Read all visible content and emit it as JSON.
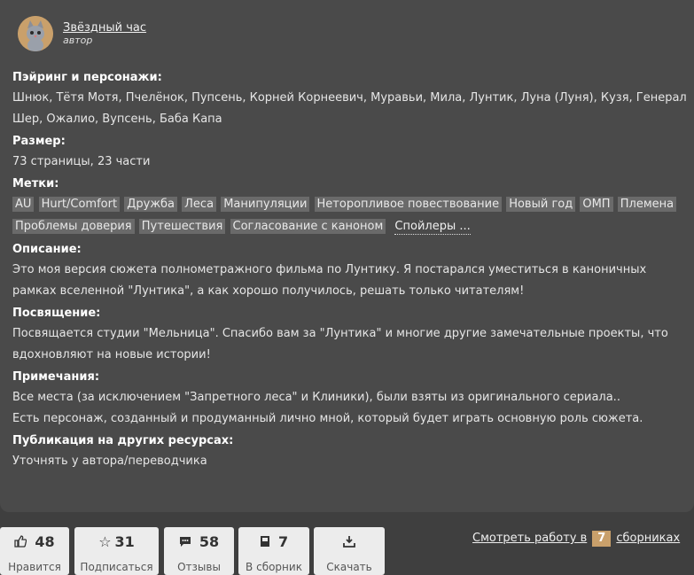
{
  "author": {
    "name": "Звёздный час",
    "role": "автор"
  },
  "sections": {
    "pairing": {
      "heading": "Пэйринг и персонажи:",
      "text": "Шнюк, Тётя Мотя, Пчелёнок, Пупсень, Корней Корнеевич, Муравьи, Мила, Лунтик, Луна (Луня), Кузя, Генерал Шер, Ожалио, Вупсень, Баба Капа"
    },
    "size": {
      "heading": "Размер:",
      "text": "73 страницы, 23 части"
    },
    "tags": {
      "heading": "Метки:",
      "items": [
        "AU",
        "Hurt/Comfort",
        "Дружба",
        "Леса",
        "Манипуляции",
        "Неторопливое повествование",
        "Новый год",
        "ОМП",
        "Племена",
        "Проблемы доверия",
        "Путешествия",
        "Согласование с каноном"
      ],
      "spoilers": "Спойлеры ..."
    },
    "description": {
      "heading": "Описание:",
      "text": "Это моя версия сюжета полнометражного фильма по Лунтику. Я постарался уместиться в каноничных рамках вселенной \"Лунтика\", а как хорошо получилось, решать только читателям!"
    },
    "dedication": {
      "heading": "Посвящение:",
      "text": "Посвящается студии \"Мельница\". Спасибо вам за \"Лунтика\" и многие другие замечательные проекты, что вдохновляют на новые истории!"
    },
    "notes": {
      "heading": "Примечания:",
      "text1": "Все места (за исключением \"Запретного леса\" и Клиники), были взяты из оригинального сериала..",
      "text2": "Есть персонаж, созданный и продуманный лично мной, который будет играть основную роль сюжета."
    },
    "publication": {
      "heading": "Публикация на других ресурсах:",
      "text": "Уточнять у автора/переводчика"
    }
  },
  "actions": {
    "like": {
      "count": "48",
      "label": "Нравится",
      "icon": "thumbs-up-icon"
    },
    "subscribe": {
      "count": "31",
      "label": "Подписаться",
      "icon": "star-icon"
    },
    "reviews": {
      "count": "58",
      "label": "Отзывы",
      "icon": "comment-icon"
    },
    "collection": {
      "count": "7",
      "label": "В сборник",
      "icon": "book-icon"
    },
    "download": {
      "label": "Скачать",
      "icon": "download-icon"
    }
  },
  "collections": {
    "text_before": "Смотреть работу в",
    "count": "7",
    "text_after": "сборниках"
  }
}
